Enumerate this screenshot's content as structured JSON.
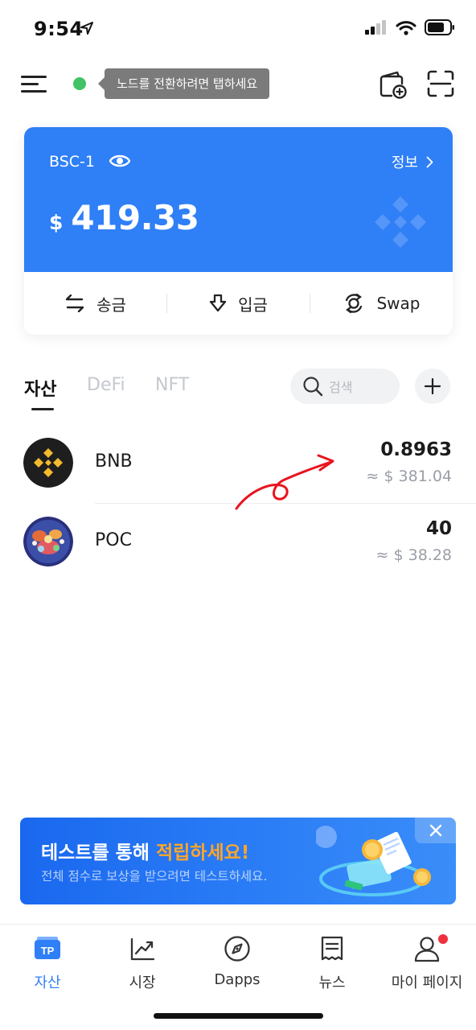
{
  "status_bar": {
    "time": "9:54"
  },
  "top_bar": {
    "node_tip": "노드를 전환하려면 탭하세요"
  },
  "wallet": {
    "name": "BSC-1",
    "info_label": "정보",
    "currency": "$",
    "balance": "419.33",
    "actions": [
      {
        "label": "송금",
        "icon": "transfer-icon"
      },
      {
        "label": "입금",
        "icon": "receive-icon"
      },
      {
        "label": "Swap",
        "icon": "swap-icon"
      }
    ]
  },
  "tabs": {
    "items": [
      "자산",
      "DeFi",
      "NFT"
    ],
    "active": "자산",
    "search_placeholder": "검색"
  },
  "tokens": [
    {
      "symbol": "BNB",
      "amount": "0.8963",
      "value": "≈ $ 381.04",
      "icon": "bnb-logo"
    },
    {
      "symbol": "POC",
      "amount": "40",
      "value": "≈ $ 38.28",
      "icon": "poc-logo"
    }
  ],
  "banner": {
    "title_prefix": "테스트를 통해 ",
    "title_highlight": "적립하세요!",
    "subtitle": "전체 점수로 보상을 받으려면 테스트하세요."
  },
  "bottom_nav": [
    {
      "label": "자산",
      "icon": "tp-wallet-icon",
      "active": true
    },
    {
      "label": "시장",
      "icon": "market-chart-icon",
      "active": false
    },
    {
      "label": "Dapps",
      "icon": "compass-icon",
      "active": false
    },
    {
      "label": "뉴스",
      "icon": "news-icon",
      "active": false
    },
    {
      "label": "마이 페이지",
      "icon": "profile-icon",
      "active": false,
      "badge": true
    }
  ],
  "colors": {
    "brand_blue": "#2f7ff7",
    "highlight_orange": "#ffa629",
    "node_green": "#41c363",
    "badge_red": "#f0303d",
    "annotation_red": "#e8141f"
  }
}
